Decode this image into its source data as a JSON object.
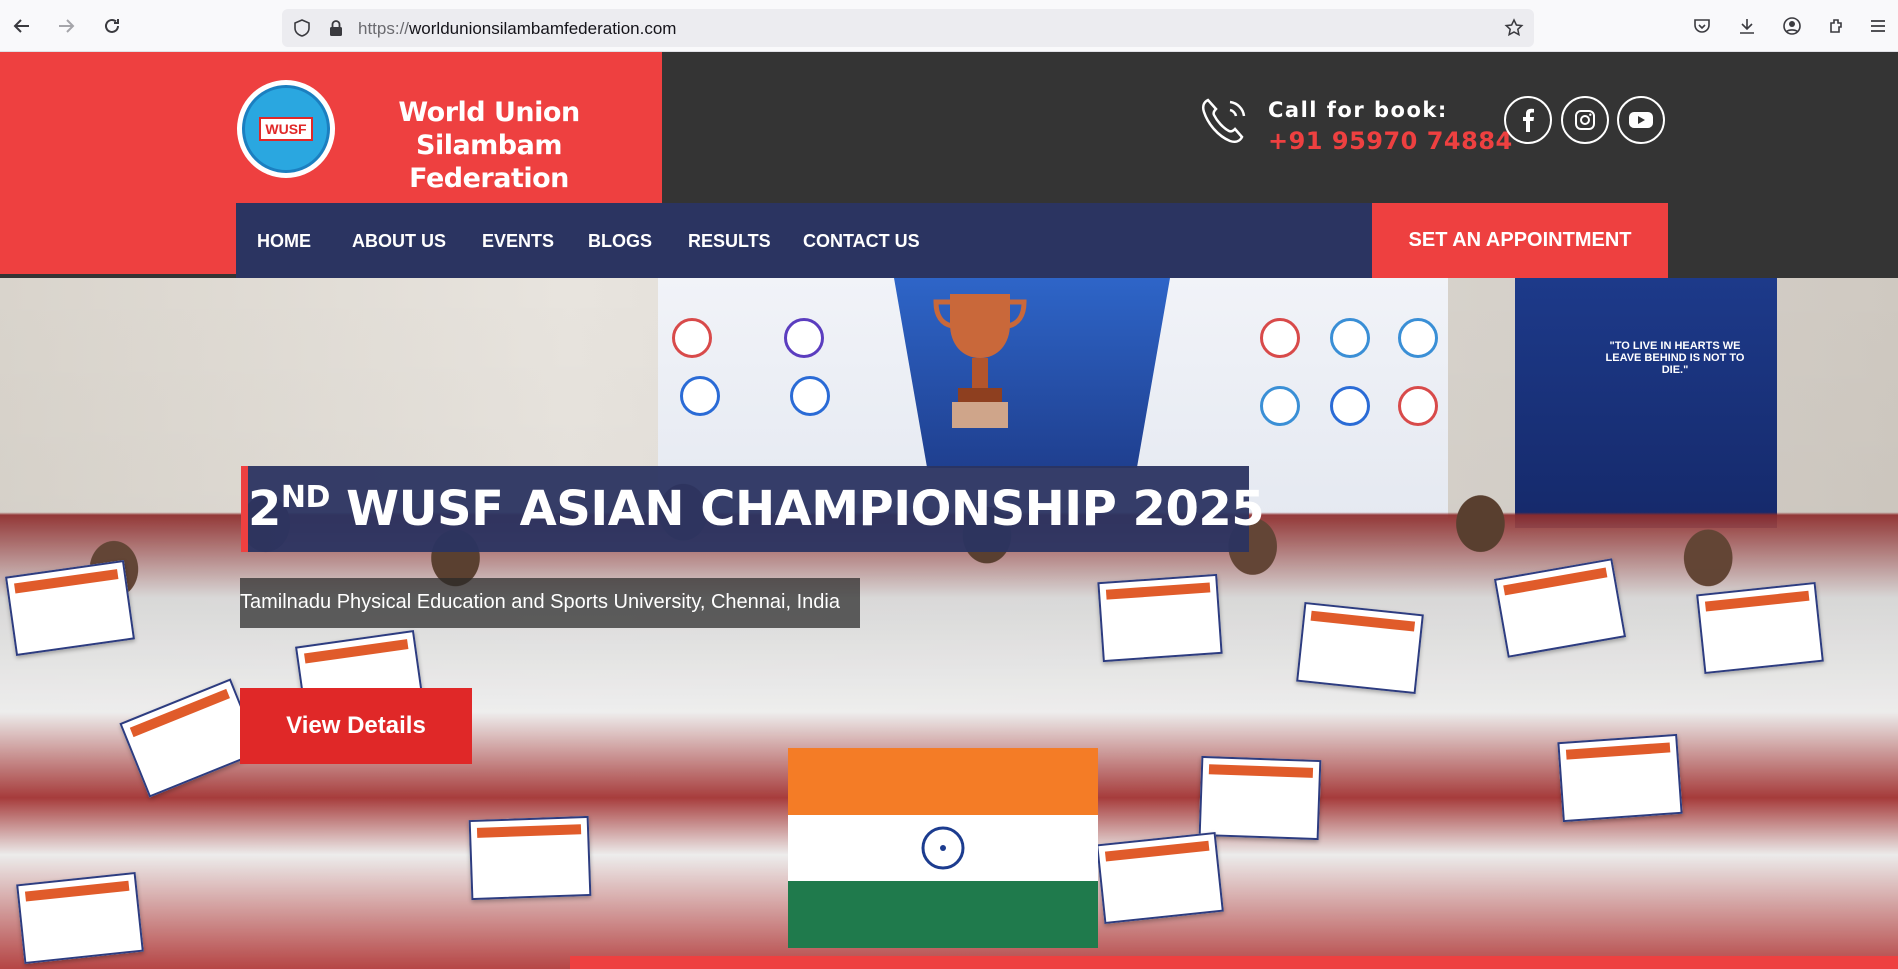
{
  "browser": {
    "url_scheme": "https://",
    "url_host": "worldunionsilambamfederation.com"
  },
  "header": {
    "logo_badge": "WUSF",
    "org_name_line1": "World Union Silambam",
    "org_name_line2": "Federation",
    "call_label": "Call for book:",
    "phone": "+91 95970 74884"
  },
  "nav": {
    "items": [
      "HOME",
      "ABOUT US",
      "EVENTS",
      "BLOGS",
      "RESULTS",
      "CONTACT US"
    ],
    "appointment": "SET AN APPOINTMENT"
  },
  "hero": {
    "title_num": "2",
    "title_sup": "ND",
    "title_rest": " WUSF ASIAN CHAMPIONSHIP 2025",
    "subtitle": "Tamilnadu Physical Education and Sports University, Chennai, India",
    "button": "View Details",
    "banner_quote": "\"TO LIVE IN HEARTS WE LEAVE BEHIND IS NOT TO DIE.\""
  },
  "colors": {
    "accent_red": "#ee4040",
    "navy": "#2b3461",
    "dark": "#343434"
  }
}
